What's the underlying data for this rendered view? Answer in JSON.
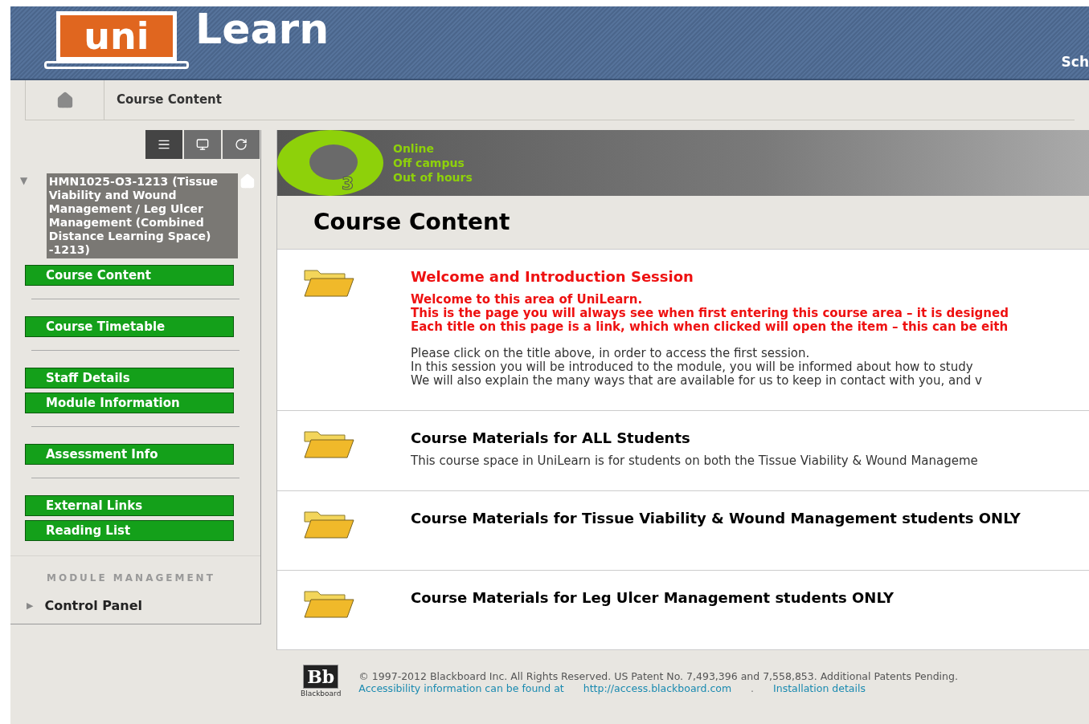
{
  "header": {
    "logo_box": "uni",
    "logo_word": "Learn",
    "right_text": "Sch"
  },
  "breadcrumb": {
    "label": "Course Content"
  },
  "sidebar": {
    "tabs": [
      {
        "kind": "list",
        "selected": true
      },
      {
        "kind": "window",
        "selected": false
      },
      {
        "kind": "refresh",
        "selected": false
      }
    ],
    "course": {
      "caret": "▼",
      "expanded": true,
      "title": "HMN1025-O3-1213 (Tissue Viability and Wound Management / Leg Ulcer Management (Combined Distance Learning Space) -1213)"
    },
    "groups": [
      {
        "items": [
          "Course Content"
        ]
      },
      {
        "items": [
          "Course Timetable"
        ]
      },
      {
        "items": [
          "Staff Details",
          "Module Information"
        ]
      },
      {
        "items": [
          "Assessment Info"
        ]
      },
      {
        "items": [
          "External Links",
          "Reading List"
        ]
      }
    ],
    "management": {
      "heading": "MODULE MANAGEMENT",
      "items": [
        {
          "caret": "▶",
          "label": "Control Panel",
          "expanded": false
        }
      ]
    }
  },
  "banner": {
    "logo_mark": "3",
    "lines": [
      "Online",
      "Off campus",
      "Out of hours"
    ]
  },
  "content": {
    "title": "Course Content",
    "items": [
      {
        "title": "Welcome and Introduction Session",
        "kind": "notice",
        "paragraphs": [
          {
            "kind": "notice",
            "lines": [
              "Welcome to this area of UniLearn.",
              "This is the page you will always see when first entering this course area – it is designed",
              "Each title on this page is a link, which when clicked will open the item – this can be eith"
            ]
          },
          {
            "kind": "plain",
            "lines": [
              "Please click on the title above, in order to access the first session.",
              "In this session you will be introduced to the module, you will be informed about how to study",
              "We will also explain the many ways that are available for us to keep in contact with you, and v"
            ]
          }
        ]
      },
      {
        "title": "Course Materials for ALL Students",
        "kind": "normal",
        "paragraphs": [
          {
            "kind": "plain",
            "lines": [
              "This course space in UniLearn is for students on both the Tissue Viability & Wound Manageme"
            ]
          }
        ]
      },
      {
        "title": "Course Materials for Tissue Viability & Wound Management students ONLY",
        "kind": "normal"
      },
      {
        "title": "Course Materials for Leg Ulcer Management students ONLY",
        "kind": "normal"
      }
    ]
  },
  "footer": {
    "logo": "Bb",
    "logo_caption": "Blackboard",
    "copyright": "© 1997-2012 Blackboard Inc. All Rights Reserved. US Patent No. 7,493,396 and 7,558,853. Additional Patents Pending.",
    "links": [
      "Accessibility information can be found at",
      "http://access.blackboard.com"
    ],
    "separator": ".",
    "last_link": "Installation details"
  }
}
